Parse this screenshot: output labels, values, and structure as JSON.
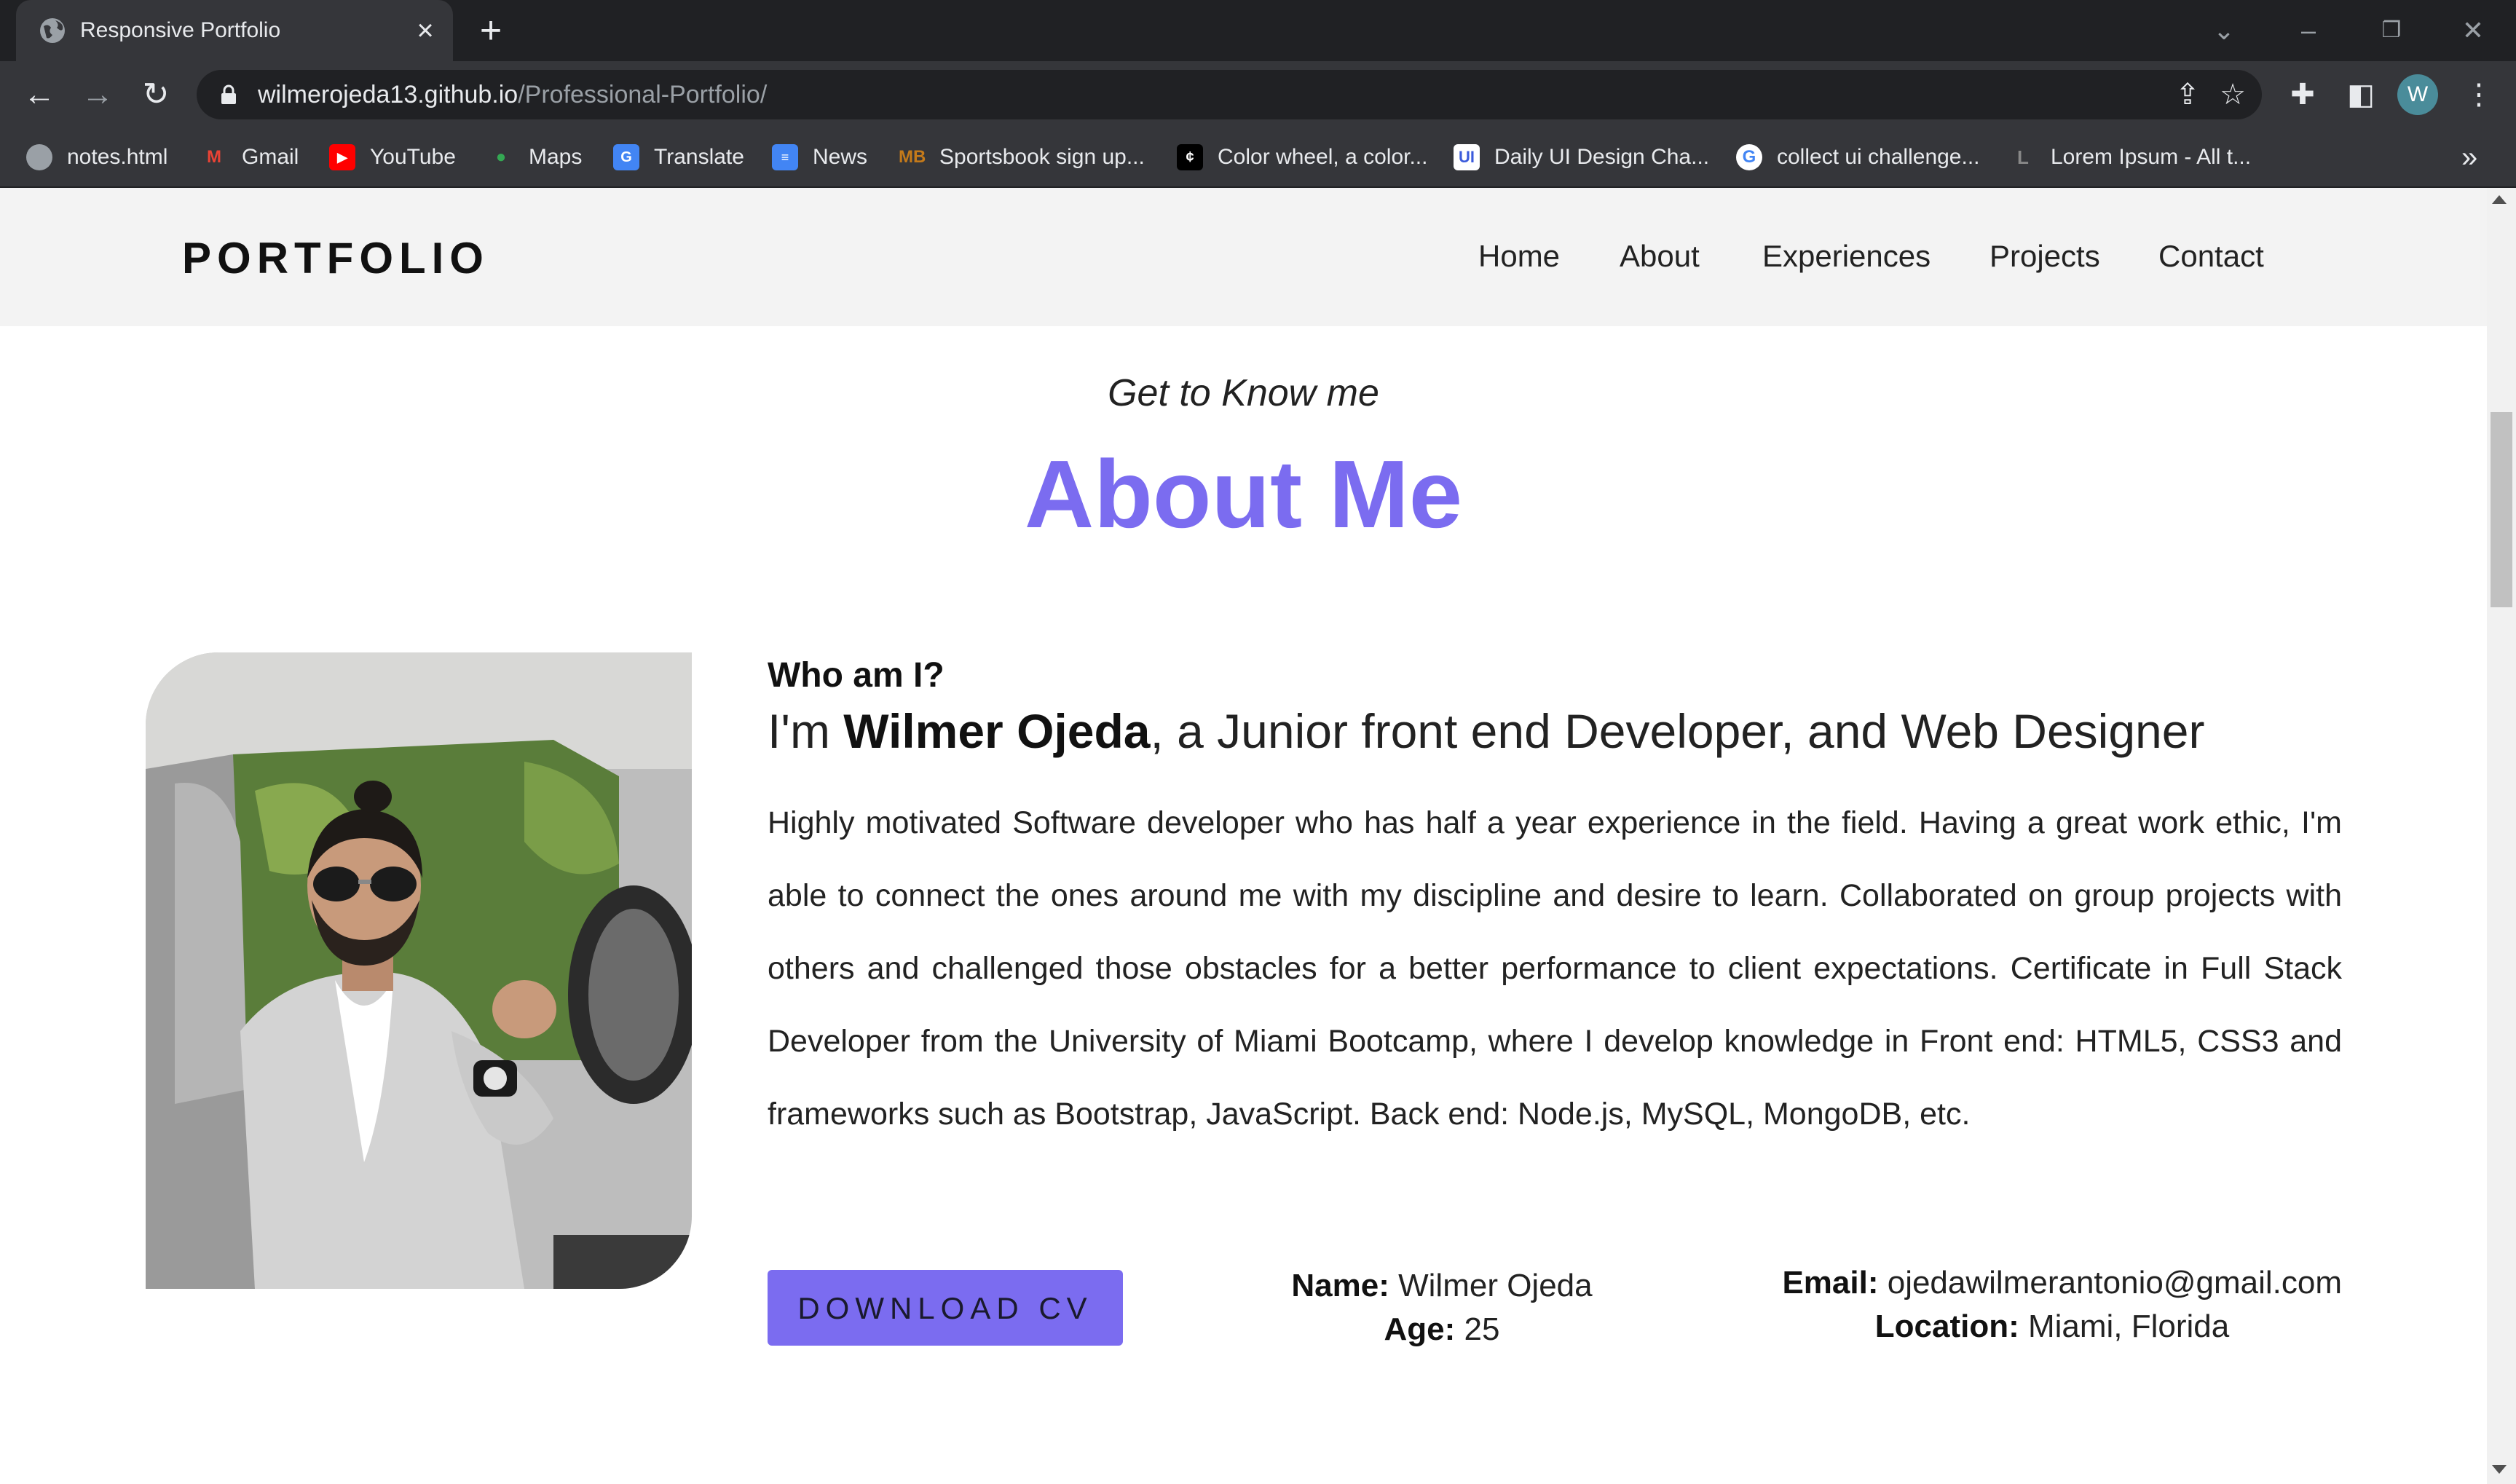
{
  "browser": {
    "tab_title": "Responsive Portfolio",
    "url_host": "wilmerojeda13.github.io",
    "url_path": "/Professional-Portfolio/",
    "profile_initial": "W",
    "bookmarks": [
      {
        "label": "notes.html",
        "icon": "globe-icon",
        "color": "#9aa0a6"
      },
      {
        "label": "Gmail",
        "icon": "gmail-icon",
        "color": "#ea4335"
      },
      {
        "label": "YouTube",
        "icon": "youtube-icon",
        "color": "#ff0000"
      },
      {
        "label": "Maps",
        "icon": "maps-icon",
        "color": "#34a853"
      },
      {
        "label": "Translate",
        "icon": "translate-icon",
        "color": "#4285f4"
      },
      {
        "label": "News",
        "icon": "news-icon",
        "color": "#4285f4"
      },
      {
        "label": "Sportsbook sign up...",
        "icon": "sportsbook-icon",
        "color": "#c47a1a"
      },
      {
        "label": "Color wheel, a color...",
        "icon": "color-wheel-icon",
        "color": "#000000"
      },
      {
        "label": "Daily UI Design Cha...",
        "icon": "daily-ui-icon",
        "color": "#3b5bdb"
      },
      {
        "label": "collect ui challenge...",
        "icon": "google-icon",
        "color": "#ffffff"
      },
      {
        "label": "Lorem Ipsum - All t...",
        "icon": "lorem-ipsum-icon",
        "color": "#444444"
      }
    ]
  },
  "site": {
    "logo": "PORTFOLIO",
    "nav": [
      "Home",
      "About",
      "Experiences",
      "Projects",
      "Contact"
    ],
    "accent_color": "#7b6cf0"
  },
  "about": {
    "eyebrow": "Get to Know me",
    "title": "About Me",
    "who_heading": "Who am I?",
    "intro_prefix": "I'm ",
    "intro_name": "Wilmer Ojeda",
    "intro_suffix": ", a Junior front end Developer, and Web Designer",
    "bio": "Highly motivated Software developer who has half a year experience in the field. Having a great work ethic, I'm able to connect the ones around me with my discipline and desire to learn. Collaborated on group projects with others and challenged those obstacles for a better performance to client expectations. Certificate in Full Stack Developer from the University of Miami Bootcamp, where I develop knowledge in Front end: HTML5, CSS3 and frameworks such as Bootstrap, JavaScript. Back end: Node.js, MySQL, MongoDB, etc.",
    "download_label": "DOWNLOAD CV",
    "name_label": "Name:",
    "name_value": "Wilmer Ojeda",
    "age_label": "Age:",
    "age_value": "25",
    "email_label": "Email:",
    "email_value": "ojedawilmerantonio@gmail.com",
    "location_label": "Location:",
    "location_value": "Miami, Florida"
  }
}
